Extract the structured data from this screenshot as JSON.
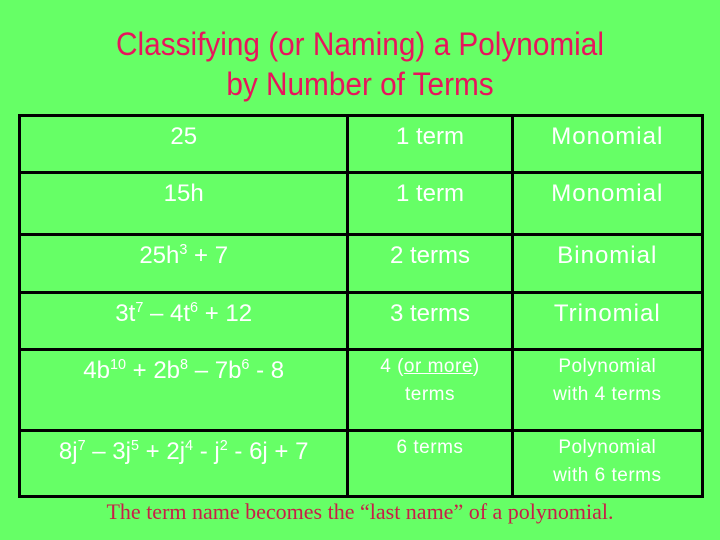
{
  "title": {
    "line1": "Classifying (or Naming) a Polynomial",
    "line2": "by Number of Terms"
  },
  "colors": {
    "background": "#66ff66",
    "title": "#e8145c",
    "footer": "#c81e48",
    "cell_text": "#ffffff",
    "grid": "#000000"
  },
  "rows": [
    {
      "expression": [
        {
          "t": "25"
        }
      ],
      "terms": "1 term",
      "name": "Monomial"
    },
    {
      "expression": [
        {
          "t": "15h"
        }
      ],
      "terms": "1 term",
      "name": "Monomial"
    },
    {
      "expression": [
        {
          "t": "25h"
        },
        {
          "sup": "3"
        },
        {
          "t": " + 7"
        }
      ],
      "terms": "2 terms",
      "name": "Binomial"
    },
    {
      "expression": [
        {
          "t": "3t"
        },
        {
          "sup": "7"
        },
        {
          "t": " – 4t"
        },
        {
          "sup": "6"
        },
        {
          "t": " + 12"
        }
      ],
      "terms": "3 terms",
      "name": "Trinomial"
    },
    {
      "expression": [
        {
          "t": "4b"
        },
        {
          "sup": "10"
        },
        {
          "t": " + 2b"
        },
        {
          "sup": "8"
        },
        {
          "t": " – 7b"
        },
        {
          "sup": "6"
        },
        {
          "t": " - 8"
        }
      ],
      "terms_prefix": "4 (",
      "terms_underlined": "or more",
      "terms_suffix": ")",
      "terms_line2": "terms",
      "name_line1": "Polynomial",
      "name_line2": "with 4 terms"
    },
    {
      "expression": [
        {
          "t": "8j"
        },
        {
          "sup": "7"
        },
        {
          "t": " – 3j"
        },
        {
          "sup": "5"
        },
        {
          "t": " + 2j"
        },
        {
          "sup": "4"
        },
        {
          "t": " - j"
        },
        {
          "sup": "2"
        },
        {
          "t": " - 6j + 7"
        }
      ],
      "terms": "6 terms",
      "name_line1": "Polynomial",
      "name_line2": "with 6 terms"
    }
  ],
  "footer": "The term name becomes the “last name” of a polynomial."
}
